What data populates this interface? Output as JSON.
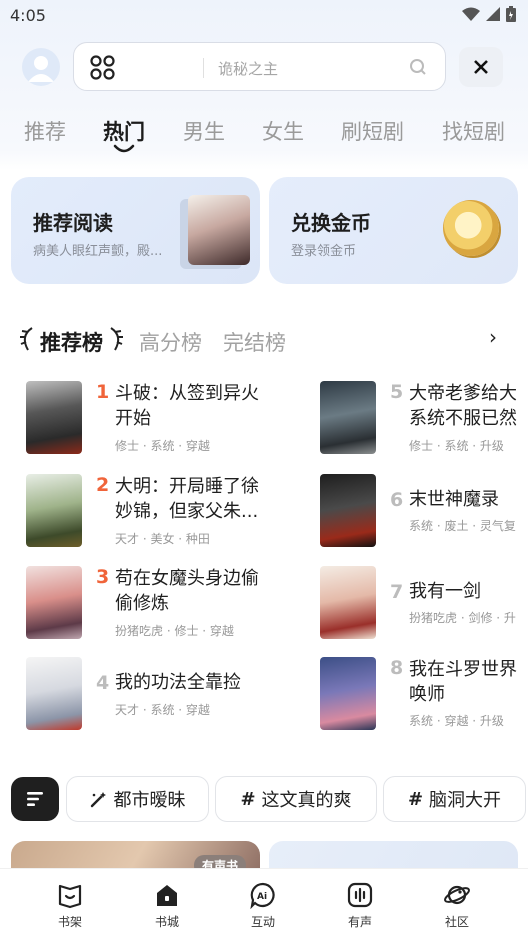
{
  "status_bar": {
    "time": "4:05"
  },
  "search": {
    "placeholder": "诡秘之主"
  },
  "tabs": [
    {
      "label": "推荐"
    },
    {
      "label": "热门"
    },
    {
      "label": "男生"
    },
    {
      "label": "女生"
    },
    {
      "label": "刷短剧"
    },
    {
      "label": "找短剧"
    }
  ],
  "promo": [
    {
      "title": "推荐阅读",
      "subtitle": "病美人眼红声颤，殿..."
    },
    {
      "title": "兑换金币",
      "subtitle": "登录领金币"
    }
  ],
  "rank_tabs": [
    {
      "label": "推荐榜"
    },
    {
      "label": "高分榜"
    },
    {
      "label": "完结榜"
    }
  ],
  "rank_list": [
    {
      "rank": "1",
      "title": "斗破：从签到异火开始",
      "tags": "修士 · 系统 · 穿越"
    },
    {
      "rank": "2",
      "title": "大明：开局睡了徐妙锦，但家父朱...",
      "tags": "天才 · 美女 · 种田"
    },
    {
      "rank": "3",
      "title": "苟在女魔头身边偷偷修炼",
      "tags": "扮猪吃虎 · 修士 · 穿越"
    },
    {
      "rank": "4",
      "title": "我的功法全靠捡",
      "tags": "天才 · 系统 · 穿越"
    },
    {
      "rank": "5",
      "title": "大帝老爹给大系统不服已然",
      "tags": "修士 · 系统 · 升级"
    },
    {
      "rank": "6",
      "title": "末世神魔录",
      "tags": "系统 · 废土 · 灵气复"
    },
    {
      "rank": "7",
      "title": "我有一剑",
      "tags": "扮猪吃虎 · 剑修 · 升"
    },
    {
      "rank": "8",
      "title": "我在斗罗世界唤师",
      "tags": "系统 · 穿越 · 升级"
    }
  ],
  "categories": [
    {
      "label": "都市暧昧"
    },
    {
      "label": "这文真的爽"
    },
    {
      "label": "脑洞大开"
    }
  ],
  "preview": {
    "badge": "有声书"
  },
  "nav": [
    {
      "label": "书架"
    },
    {
      "label": "书城"
    },
    {
      "label": "互动"
    },
    {
      "label": "有声"
    },
    {
      "label": "社区"
    }
  ],
  "colors": {
    "rank_top": "#f0643a",
    "rank_other": "#b8b8b8",
    "accent": "#1f1f1f"
  }
}
